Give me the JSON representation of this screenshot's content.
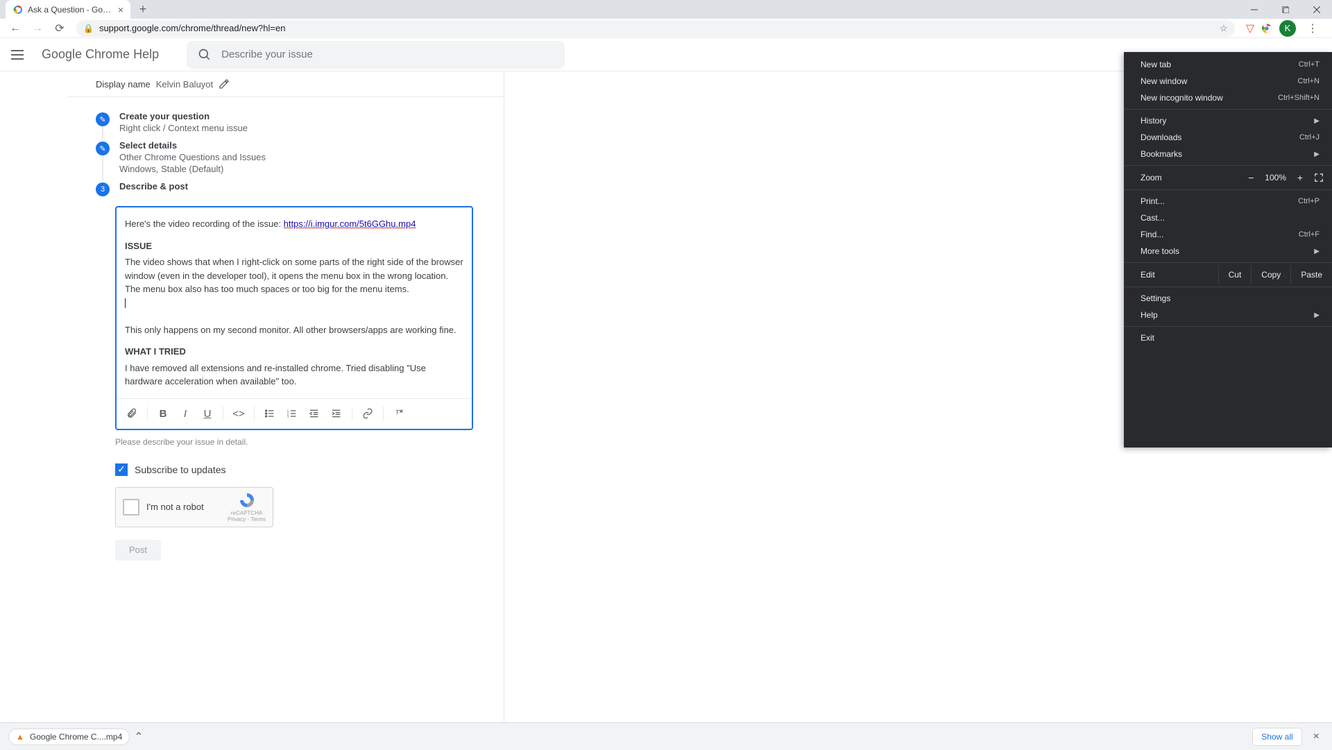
{
  "browser": {
    "tab_title": "Ask a Question - Google Chrome",
    "url": "support.google.com/chrome/thread/new?hl=en",
    "avatar_letter": "K"
  },
  "help_header": {
    "title": "Google Chrome Help",
    "search_placeholder": "Describe your issue"
  },
  "display_name": {
    "label": "Display name",
    "value": "Kelvin Baluyot"
  },
  "steps": {
    "create": {
      "title": "Create your question",
      "sub": "Right click / Context menu issue"
    },
    "select": {
      "title": "Select details",
      "sub1": "Other Chrome Questions and Issues",
      "sub2": "Windows, Stable (Default)"
    },
    "describe": {
      "title": "Describe & post",
      "num": "3"
    }
  },
  "editor": {
    "line1_prefix": "Here's the video recording of the issue: ",
    "link_text": "https://i.imgur.com/5t6GGhu.mp4",
    "h_issue": "ISSUE",
    "para_issue": "The video shows that when I right-click on some parts of the right side of the browser window (even in the developer tool), it opens the menu box in the wrong location. The menu box also has too much spaces or too big for the menu items.",
    "para_monitor": "This only happens on my second monitor. All other browsers/apps are working fine.",
    "h_tried": "WHAT I TRIED",
    "para_tried": "I have removed all extensions and re-installed chrome. Tried disabling \"Use hardware acceleration when available\" too.",
    "helper": "Please describe your issue in detail."
  },
  "subscribe_label": "Subscribe to updates",
  "recaptcha": {
    "text": "I'm not a robot",
    "brand": "reCAPTCHA",
    "legal": "Privacy - Terms"
  },
  "post_label": "Post",
  "chrome_menu": {
    "new_tab": "New tab",
    "new_tab_sc": "Ctrl+T",
    "new_window": "New window",
    "new_window_sc": "Ctrl+N",
    "new_incognito": "New incognito window",
    "new_incognito_sc": "Ctrl+Shift+N",
    "history": "History",
    "downloads": "Downloads",
    "downloads_sc": "Ctrl+J",
    "bookmarks": "Bookmarks",
    "zoom": "Zoom",
    "zoom_value": "100%",
    "print": "Print...",
    "print_sc": "Ctrl+P",
    "cast": "Cast...",
    "find": "Find...",
    "find_sc": "Ctrl+F",
    "more_tools": "More tools",
    "edit": "Edit",
    "cut": "Cut",
    "copy": "Copy",
    "paste": "Paste",
    "settings": "Settings",
    "help": "Help",
    "exit": "Exit"
  },
  "download": {
    "filename": "Google Chrome C....mp4",
    "show_all": "Show all"
  }
}
